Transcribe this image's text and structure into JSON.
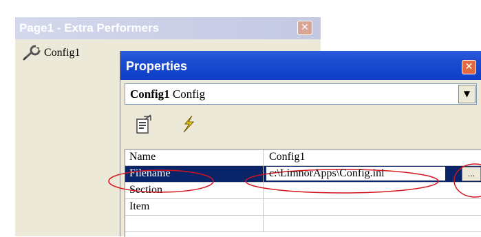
{
  "back_window": {
    "title": "Page1 - Extra Performers",
    "close_glyph": "✕",
    "tree_item": {
      "label": "Config1",
      "icon": "wrench-icon"
    }
  },
  "properties_window": {
    "title": "Properties",
    "close_glyph": "✕",
    "object_selector": {
      "name": "Config1",
      "type": "Config",
      "dropdown_glyph": "▼"
    },
    "toolbar": [
      {
        "name": "properties-view-icon",
        "tooltip": ""
      },
      {
        "name": "events-view-icon",
        "tooltip": ""
      }
    ],
    "grid": {
      "rows": [
        {
          "name": "Name",
          "value": "Config1",
          "selected": false
        },
        {
          "name": "Filename",
          "value": "c:\\LimnorApps\\Config.ini",
          "selected": true,
          "ellipsis": "..."
        },
        {
          "name": "Section",
          "value": "",
          "selected": false
        },
        {
          "name": "Item",
          "value": "",
          "selected": false
        }
      ]
    }
  },
  "colors": {
    "title_active": "#0d3fc6",
    "title_inactive": "#c9cee6",
    "selection": "#0a246a",
    "annotation_red": "#d4141f"
  }
}
